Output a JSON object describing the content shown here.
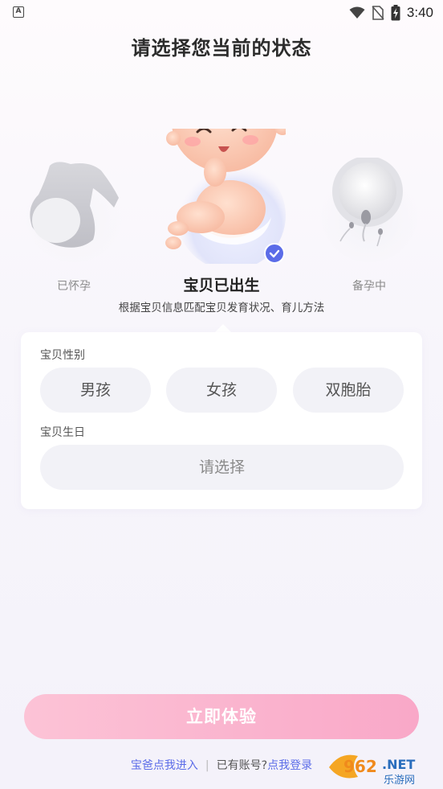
{
  "status_bar": {
    "app_badge": "A",
    "time": "3:40",
    "icons": [
      "wifi-icon",
      "no-sim-icon",
      "battery-charging-icon"
    ]
  },
  "page": {
    "title": "请选择您当前的状态",
    "subtitle": "根据宝贝信息匹配宝贝发育状况、育儿方法"
  },
  "status_options": [
    {
      "label": "已怀孕",
      "icon": "pregnant-silhouette-icon",
      "selected": false
    },
    {
      "label": "宝贝已出生",
      "icon": "baby-icon",
      "selected": true
    },
    {
      "label": "备孕中",
      "icon": "egg-sperm-icon",
      "selected": false
    }
  ],
  "form": {
    "gender_label": "宝贝性别",
    "gender_options": [
      "男孩",
      "女孩",
      "双胞胎"
    ],
    "birthday_label": "宝贝生日",
    "birthday_placeholder": "请选择"
  },
  "cta": {
    "label": "立即体验"
  },
  "footer": {
    "dad_link": "宝爸点我进入",
    "separator": "|",
    "has_account": "已有账号?",
    "login_link": "点我登录"
  },
  "watermark": {
    "text": "962.NET",
    "sub": "乐游网"
  },
  "colors": {
    "accent": "#5b6ce8",
    "cta_gradient_start": "#fcc3d6",
    "cta_gradient_end": "#f9a8c8",
    "pill_bg": "#f2f2f7"
  }
}
